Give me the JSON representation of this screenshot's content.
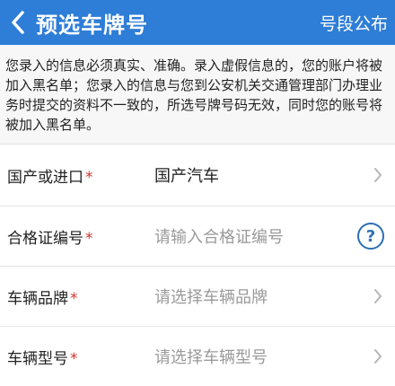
{
  "header": {
    "title": "预选车牌号",
    "action_label": "号段公布"
  },
  "notice": {
    "text": "您录入的信息必须真实、准确。录入虚假信息的，您的账户将被加入黑名单；您录入的信息与您到公安机关交通管理部门办理业务时提交的资料不一致的，所选号牌号码无效，同时您的账号将被加入黑名单。"
  },
  "form": {
    "required_mark": "*",
    "fields": [
      {
        "label": "国产或进口",
        "value": "国产汽车",
        "placeholder": ""
      },
      {
        "label": "合格证编号",
        "value": "",
        "placeholder": "请输入合格证编号",
        "help_icon": "?"
      },
      {
        "label": "车辆品牌",
        "value": "",
        "placeholder": "请选择车辆品牌"
      },
      {
        "label": "车辆型号",
        "value": "",
        "placeholder": "请选择车辆型号"
      }
    ]
  }
}
